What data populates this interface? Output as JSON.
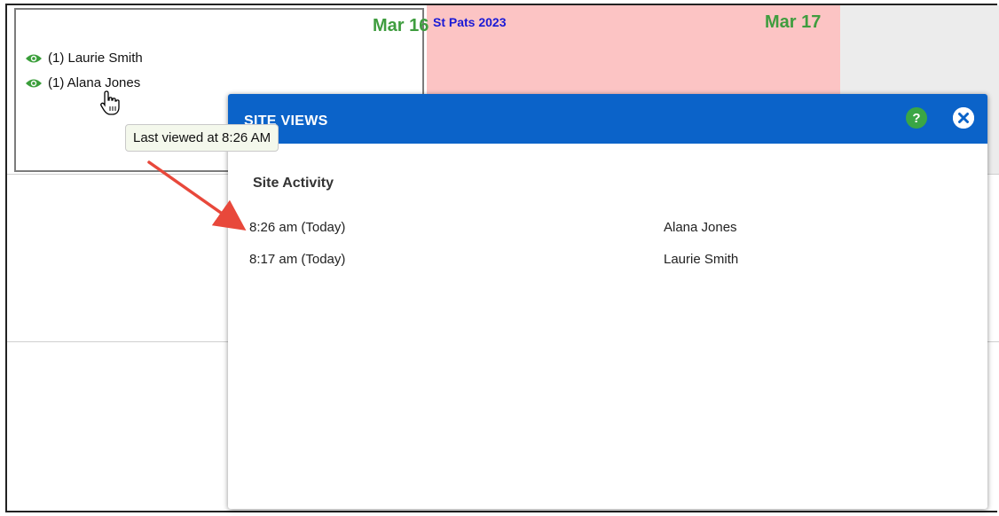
{
  "calendar": {
    "cells": [
      {
        "date": "Mar 16",
        "viewers": [
          "(1) Laurie Smith",
          "(1) Alana Jones"
        ]
      },
      {
        "date": "Mar 17",
        "event": "St Pats 2023"
      }
    ]
  },
  "tooltip": {
    "text": "Last viewed at 8:26 AM"
  },
  "modal": {
    "title": "SITE VIEWS",
    "section_title": "Site Activity",
    "activity": [
      {
        "time": "8:26 am (Today)",
        "name": "Alana Jones"
      },
      {
        "time": "8:17 am (Today)",
        "name": "Laurie Smith"
      }
    ]
  },
  "icons": {
    "viewer": "eye-icon",
    "help": "help-icon",
    "close": "close-icon",
    "cursor": "hand-cursor-icon",
    "annotation": "red-arrow"
  },
  "colors": {
    "date_green": "#3f9d3f",
    "event_blue": "#1a1ad6",
    "event_bg": "#fcc4c4",
    "modal_header": "#0b63c9",
    "help_green": "#3aa645",
    "arrow_red": "#e8483b"
  }
}
